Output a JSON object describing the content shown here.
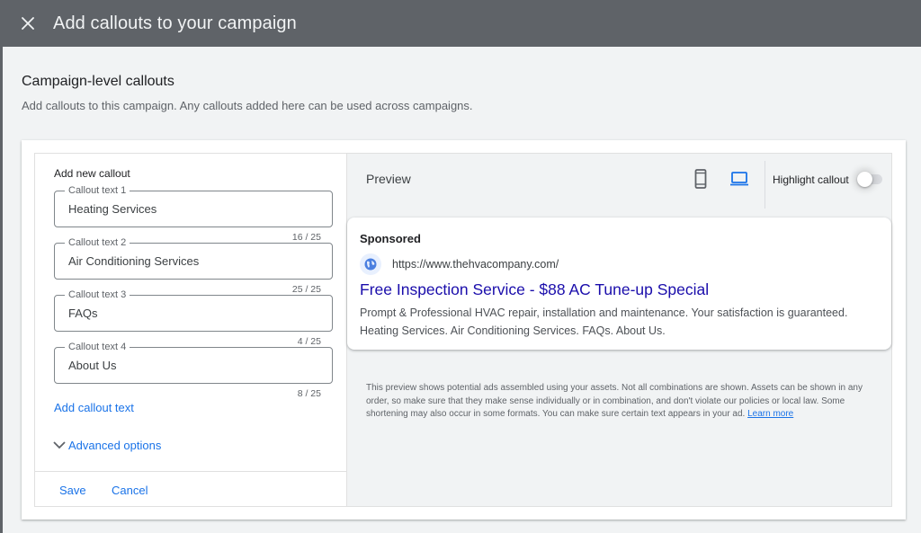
{
  "dialog": {
    "title": "Add callouts to your campaign",
    "close_icon": "close-icon"
  },
  "section": {
    "title": "Campaign-level callouts",
    "description": "Add callouts to this campaign. Any callouts added here can be used across campaigns."
  },
  "editor": {
    "heading": "Add new callout",
    "fields": [
      {
        "label": "Callout text 1",
        "value": "Heating Services",
        "counter": "16 / 25"
      },
      {
        "label": "Callout text 2",
        "value": "Air Conditioning Services",
        "counter": "25 / 25"
      },
      {
        "label": "Callout text 3",
        "value": "FAQs",
        "counter": "4 / 25"
      },
      {
        "label": "Callout text 4",
        "value": "About Us",
        "counter": "8 / 25"
      }
    ],
    "add_link": "Add callout text",
    "advanced_options": "Advanced options",
    "advanced_icon": "chevron-down-icon",
    "save_label": "Save",
    "cancel_label": "Cancel"
  },
  "preview": {
    "title": "Preview",
    "device_icons": [
      "mobile-icon",
      "desktop-icon"
    ],
    "selected_device": "desktop",
    "highlight_label": "Highlight callout",
    "highlight_enabled": false,
    "ad": {
      "sponsored": "Sponsored",
      "url": "https://www.thehvacompany.com/",
      "headline": "Free Inspection Service - $88 AC Tune-up Special",
      "description": "Prompt & Professional HVAC repair, installation and maintenance. Your satisfaction is guaranteed. Heating Services. Air Conditioning Services. FAQs. About Us."
    },
    "disclaimer": "This preview shows potential ads assembled using your assets. Not all combinations are shown. Assets can be shown in any order, so make sure that they make sense individually or in combination, and don't violate our policies or local law. Some shortening may also occur in some formats. You can make sure certain text appears in your ad.",
    "learn_more": "Learn more"
  },
  "colors": {
    "accent": "#1a73e8",
    "headline_link": "#1a0dab",
    "header_bg": "#5f6368",
    "page_bg": "#f1f3f4"
  }
}
